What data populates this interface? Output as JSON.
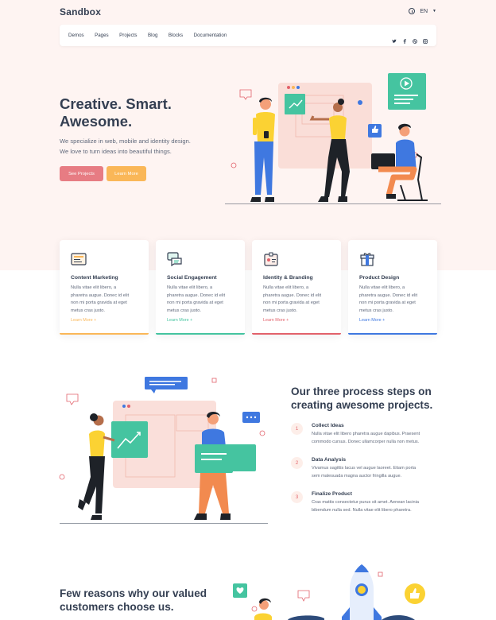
{
  "brand": {
    "logo": "Sandbox"
  },
  "header": {
    "language": "EN"
  },
  "nav": {
    "links": [
      "Demos",
      "Pages",
      "Projects",
      "Blog",
      "Blocks",
      "Documentation"
    ]
  },
  "hero": {
    "title_lines": [
      "Creative. Smart.",
      "Awesome."
    ],
    "text_lines": [
      "We specialize in web, mobile and identity design.",
      "We love to turn ideas into beautiful things."
    ],
    "primary_button": "See Projects",
    "secondary_button": "Learn More"
  },
  "services": [
    {
      "title": "Content Marketing",
      "lines": [
        "Nulla vitae elit libero, a",
        "pharetra augue. Donec id elit",
        "non mi porta gravida at eget",
        "metus cras justo."
      ],
      "link": "Learn More +",
      "color": "#fab758",
      "icon": "newspaper-icon"
    },
    {
      "title": "Social Engagement",
      "lines": [
        "Nulla vitae elit libero, a",
        "pharetra augue. Donec id elit",
        "non mi porta gravida at eget",
        "metus cras justo."
      ],
      "link": "Learn More +",
      "color": "#45c4a0",
      "icon": "chat-bubbles-icon"
    },
    {
      "title": "Identity & Branding",
      "lines": [
        "Nulla vitae elit libero, a",
        "pharetra augue. Donec id elit",
        "non mi porta gravida at eget",
        "metus cras justo."
      ],
      "link": "Learn More +",
      "color": "#e2626b",
      "icon": "id-card-icon"
    },
    {
      "title": "Product Design",
      "lines": [
        "Nulla vitae elit libero, a",
        "pharetra augue. Donec id elit",
        "non mi porta gravida at eget",
        "metus cras justo."
      ],
      "link": "Learn More +",
      "color": "#3f78e0",
      "icon": "package-icon"
    }
  ],
  "process": {
    "title_lines": [
      "Our three process steps on",
      "creating awesome projects."
    ],
    "steps": [
      {
        "num": "1",
        "title": "Collect Ideas",
        "lines": [
          "Nulla vitae elit libero pharetra augue dapibus. Praesent",
          "commodo cursus. Donec ullamcorper nulla non metus."
        ]
      },
      {
        "num": "2",
        "title": "Data Analysis",
        "lines": [
          "Vivamus sagittis lacus vel augue laoreet. Etiam porta",
          "sem malesuada magna auctor fringilla augue."
        ]
      },
      {
        "num": "3",
        "title": "Finalize Product",
        "lines": [
          "Cras mattis consectetur purus sit amet. Aenean lacinia",
          "bibendum nulla sed. Nulla vitae elit libero pharetra."
        ]
      }
    ]
  },
  "reasons": {
    "title_lines": [
      "Few reasons why our valued",
      "customers choose us."
    ]
  },
  "colors": {
    "accent_red": "#e2626b",
    "accent_yellow": "#fab758",
    "accent_green": "#45c4a0",
    "accent_blue": "#3f78e0",
    "hero_bg": "#fef4f2"
  }
}
